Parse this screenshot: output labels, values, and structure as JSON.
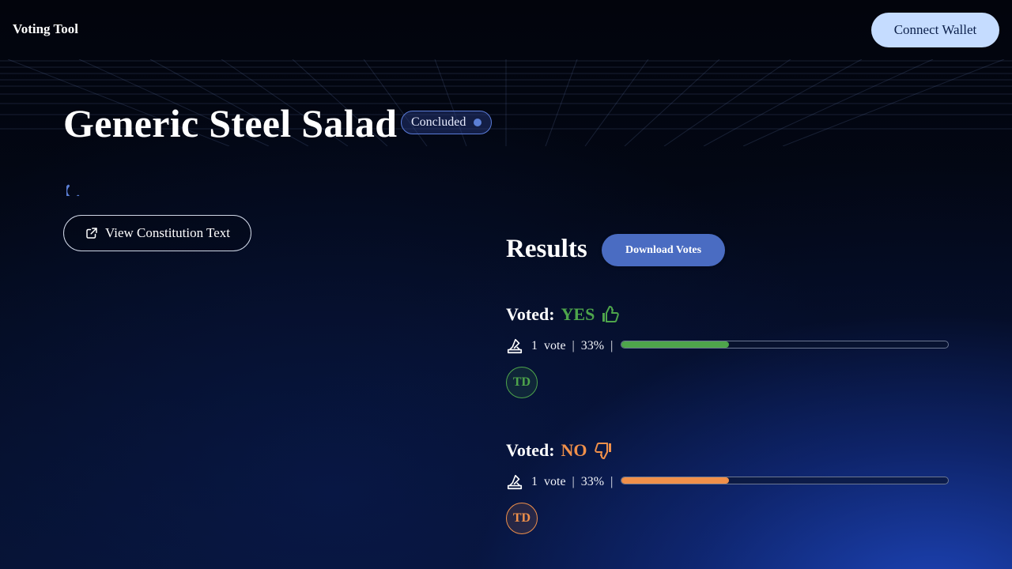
{
  "header": {
    "brand": "Voting Tool",
    "connect_label": "Connect Wallet"
  },
  "proposal": {
    "title": "Generic Steel Salad",
    "status": "Concluded",
    "view_text_label": "View Constitution Text"
  },
  "results": {
    "title": "Results",
    "download_label": "Download Votes",
    "groups": [
      {
        "prefix": "Voted:",
        "choice": "YES",
        "icon": "thumbs-up-icon",
        "count": "1",
        "unit": "vote",
        "percent_label": "33%",
        "percent": 33,
        "color": "#4ea54b",
        "avatar": "TD"
      },
      {
        "prefix": "Voted:",
        "choice": "NO",
        "icon": "thumbs-down-icon",
        "count": "1",
        "unit": "vote",
        "percent_label": "33%",
        "percent": 33,
        "color": "#f0904a",
        "avatar": "TD"
      }
    ]
  },
  "colors": {
    "accent": "#4a6cc2",
    "connect_bg": "#c5dcff",
    "yes": "#4ea54b",
    "no": "#f0904a"
  }
}
